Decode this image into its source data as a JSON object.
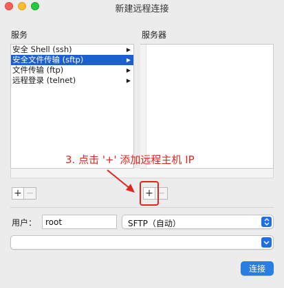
{
  "window": {
    "title": "新建远程连接"
  },
  "services": {
    "label": "服务",
    "items": [
      {
        "label": "安全 Shell (ssh)",
        "selected": false
      },
      {
        "label": "安全文件传输 (sftp)",
        "selected": true
      },
      {
        "label": "文件传输 (ftp)",
        "selected": false
      },
      {
        "label": "远程登录 (telnet)",
        "selected": false
      }
    ]
  },
  "servers": {
    "label": "服务器"
  },
  "buttons": {
    "plus": "+",
    "minus": "−",
    "connect": "连接"
  },
  "annotation": {
    "text": "3. 点击 '+' 添加远程主机 IP",
    "color": "#e0251b"
  },
  "user": {
    "label": "用户：",
    "value": "root"
  },
  "protocol": {
    "selected": "SFTP（自动）"
  },
  "host": {
    "selected": ""
  },
  "colors": {
    "accent": "#2a7de1",
    "selection": "#1b5fd1"
  }
}
